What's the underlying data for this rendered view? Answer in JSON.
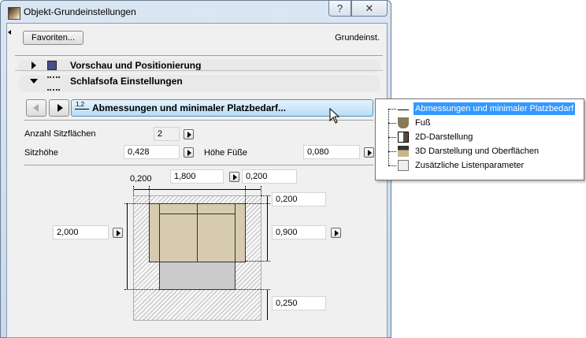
{
  "window": {
    "title": "Objekt-Grundeinstellungen",
    "help": "?",
    "close": "✕"
  },
  "header": {
    "favorites_label": "Favoriten...",
    "preset_label": "Grundeinst."
  },
  "sections": [
    {
      "label": "Vorschau und Positionierung",
      "expanded": false
    },
    {
      "label": "Schlafsofa Einstellungen",
      "expanded": true
    }
  ],
  "page_nav": {
    "current": "Abmessungen und minimaler Platzbedarf...",
    "icon_text": "1,2"
  },
  "params": {
    "seats_label": "Anzahl Sitzflächen",
    "seats_value": "2",
    "seat_height_label": "Sitzhöhe",
    "seat_height_value": "0,428",
    "foot_height_label": "Höhe Füße",
    "foot_height_value": "0,080"
  },
  "diagram": {
    "left_clearance": "0,200",
    "width": "1,800",
    "right_clearance": "0,200",
    "back_clearance": "0,200",
    "depth": "0,900",
    "front_clearance": "0,250",
    "total_depth": "2,000"
  },
  "popup": {
    "items": [
      {
        "label": "Abmessungen und minimaler Platzbedarf",
        "selected": true
      },
      {
        "label": "Fuß"
      },
      {
        "label": "2D-Darstellung"
      },
      {
        "label": "3D Darstellung und Oberflächen"
      },
      {
        "label": "Zusätzliche Listenparameter"
      }
    ]
  },
  "colors": {
    "selection": "#3399ff",
    "sofa": "#d6cbaf",
    "bed": "#cbcbcb"
  }
}
